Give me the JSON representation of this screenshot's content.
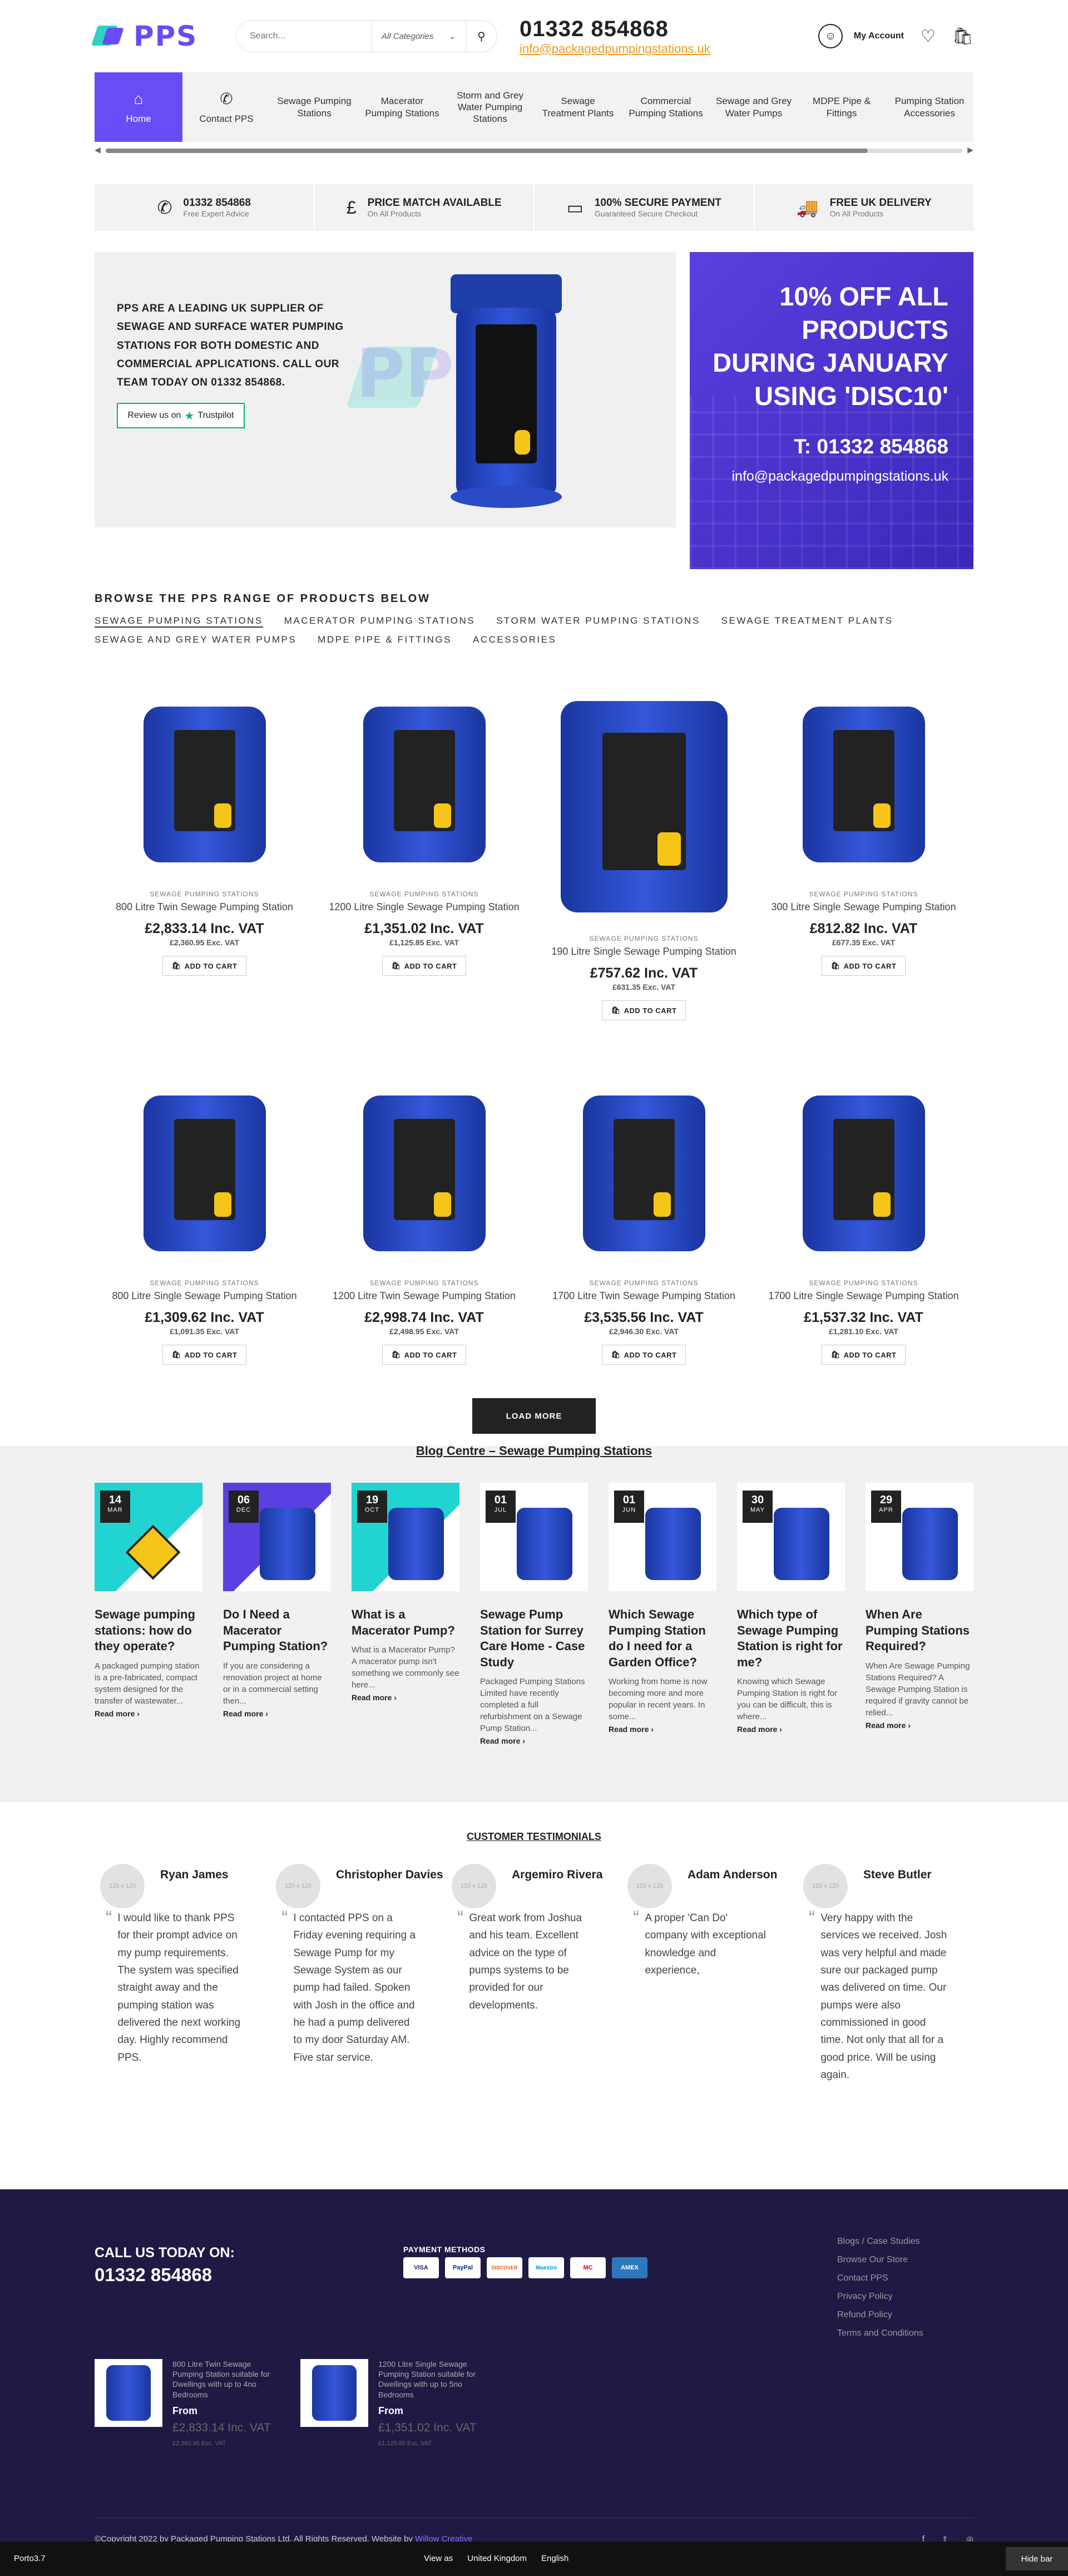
{
  "header": {
    "logo_text": "PPS",
    "search_placeholder": "Search...",
    "search_category": "All Categories",
    "phone": "01332 854868",
    "email": "info@packagedpumpingstations.uk",
    "account_label": "My Account"
  },
  "nav": {
    "items": [
      {
        "label": "Home",
        "icon": "home-icon"
      },
      {
        "label": "Contact PPS",
        "icon": "phone-icon"
      },
      {
        "label": "Sewage Pumping Stations"
      },
      {
        "label": "Macerator Pumping Stations"
      },
      {
        "label": "Storm and Grey Water Pumping Stations"
      },
      {
        "label": "Sewage Treatment Plants"
      },
      {
        "label": "Commercial Pumping Stations"
      },
      {
        "label": "Sewage and Grey Water Pumps"
      },
      {
        "label": "MDPE Pipe & Fittings"
      },
      {
        "label": "Pumping Station Accessories"
      }
    ]
  },
  "features": [
    {
      "title": "01332 854868",
      "sub": "Free Expert Advice",
      "icon": "phone-icon"
    },
    {
      "title": "PRICE MATCH AVAILABLE",
      "sub": "On All Products",
      "icon": "pound-icon"
    },
    {
      "title": "100% SECURE PAYMENT",
      "sub": "Guaranteed Secure Checkout",
      "icon": "card-icon"
    },
    {
      "title": "FREE UK DELIVERY",
      "sub": "On All Products",
      "icon": "truck-icon"
    }
  ],
  "hero": {
    "text": "PPS ARE A LEADING UK SUPPLIER OF SEWAGE AND SURFACE WATER PUMPING STATIONS FOR BOTH DOMESTIC AND COMMERCIAL APPLICATIONS. CALL OUR TEAM TODAY ON 01332 854868.",
    "trustpilot": "Review us on",
    "trustpilot_brand": "Trustpilot",
    "watermark": "PPS",
    "promo": "10% OFF ALL PRODUCTS DURING JANUARY USING 'DISC10'",
    "promo_phone": "T: 01332 854868",
    "promo_email": "info@packagedpumpingstations.uk"
  },
  "browse": {
    "title": "BROWSE THE PPS RANGE OF PRODUCTS BELOW",
    "tabs": [
      "SEWAGE PUMPING STATIONS",
      "MACERATOR PUMPING STATIONS",
      "STORM WATER PUMPING STATIONS",
      "SEWAGE TREATMENT PLANTS",
      "SEWAGE AND GREY WATER PUMPS",
      "MDPE PIPE & FITTINGS",
      "ACCESSORIES"
    ]
  },
  "products": [
    {
      "cat": "SEWAGE PUMPING STATIONS",
      "name": "800 Litre Twin Sewage Pumping Station",
      "price": "£2,833.14 Inc. VAT",
      "ex": "£2,360.95 Exc. VAT",
      "cart": "ADD TO CART"
    },
    {
      "cat": "SEWAGE PUMPING STATIONS",
      "name": "1200 Litre Single Sewage Pumping Station",
      "price": "£1,351.02 Inc. VAT",
      "ex": "£1,125.85 Exc. VAT",
      "cart": "ADD TO CART"
    },
    {
      "cat": "SEWAGE PUMPING STATIONS",
      "name": "190 Litre Single Sewage Pumping Station",
      "price": "£757.62 Inc. VAT",
      "ex": "£631.35 Exc. VAT",
      "cart": "ADD TO CART"
    },
    {
      "cat": "SEWAGE PUMPING STATIONS",
      "name": "300 Litre Single Sewage Pumping Station",
      "price": "£812.82 Inc. VAT",
      "ex": "£677.35 Exc. VAT",
      "cart": "ADD TO CART"
    },
    {
      "cat": "SEWAGE PUMPING STATIONS",
      "name": "800 Litre Single Sewage Pumping Station",
      "price": "£1,309.62 Inc. VAT",
      "ex": "£1,091.35 Exc. VAT",
      "cart": "ADD TO CART"
    },
    {
      "cat": "SEWAGE PUMPING STATIONS",
      "name": "1200 Litre Twin Sewage Pumping Station",
      "price": "£2,998.74 Inc. VAT",
      "ex": "£2,498.95 Exc. VAT",
      "cart": "ADD TO CART"
    },
    {
      "cat": "SEWAGE PUMPING STATIONS",
      "name": "1700 Litre Twin Sewage Pumping Station",
      "price": "£3,535.56 Inc. VAT",
      "ex": "£2,946.30 Exc. VAT",
      "cart": "ADD TO CART"
    },
    {
      "cat": "SEWAGE PUMPING STATIONS",
      "name": "1700 Litre Single Sewage Pumping Station",
      "price": "£1,537.32 Inc. VAT",
      "ex": "£1,281.10 Exc. VAT",
      "cart": "ADD TO CART"
    }
  ],
  "load_more": "LOAD MORE",
  "blog": {
    "title": "Blog Centre – Sewage Pumping Stations",
    "posts": [
      {
        "day": "14",
        "month": "MAR",
        "title": "Sewage pumping stations: how do they operate?",
        "excerpt": "A packaged pumping station is a pre-fabricated, compact system designed for the transfer of wastewater...",
        "more": "Read more ›"
      },
      {
        "day": "06",
        "month": "DEC",
        "title": "Do I Need a Macerator Pumping Station?",
        "excerpt": "If you are considering a renovation project at home or in a commercial setting then...",
        "more": "Read more ›"
      },
      {
        "day": "19",
        "month": "OCT",
        "title": "What is a Macerator Pump?",
        "excerpt": "What is a Macerator Pump? A macerator pump isn't something we commonly see here...",
        "more": "Read more ›"
      },
      {
        "day": "01",
        "month": "JUL",
        "title": "Sewage Pump Station for Surrey Care Home - Case Study",
        "excerpt": "Packaged Pumping Stations Limited have recently completed a full refurbishment on a Sewage Pump Station...",
        "more": "Read more ›"
      },
      {
        "day": "01",
        "month": "JUN",
        "title": "Which Sewage Pumping Station do I need for a Garden Office?",
        "excerpt": "Working from home is now becoming more and more popular in recent years. In some...",
        "more": "Read more ›"
      },
      {
        "day": "30",
        "month": "MAY",
        "title": "Which type of Sewage Pumping Station is right for me?",
        "excerpt": "Knowing which Sewage Pumping Station is right for you can be difficult, this is where...",
        "more": "Read more ›"
      },
      {
        "day": "29",
        "month": "APR",
        "title": "When Are Pumping Stations Required?",
        "excerpt": "When Are Sewage Pumping Stations Required? A Sewage Pumping Station is required if gravity cannot be relied...",
        "more": "Read more ›"
      }
    ]
  },
  "testimonials": {
    "title": "CUSTOMER TESTIMONIALS",
    "avatar_text": "120 x 120",
    "items": [
      {
        "name": "Ryan James",
        "text": "I would like to thank PPS for their prompt advice on my pump requirements. The system was specified straight away and the pumping station was delivered the next working day. Highly recommend PPS."
      },
      {
        "name": "Christopher Davies",
        "text": "I contacted PPS on a Friday evening requiring a Sewage Pump for my Sewage System as our pump had failed. Spoken with Josh in the office and he had a pump delivered to my door Saturday AM. Five star service."
      },
      {
        "name": "Argemiro Rivera",
        "text": "Great work from Joshua and his team. Excellent advice on the type of pumps systems to be provided for our developments."
      },
      {
        "name": "Adam Anderson",
        "text": "A proper 'Can Do' company with exceptional knowledge and experience,"
      },
      {
        "name": "Steve Butler",
        "text": "Very happy with the services we received. Josh was very helpful and made sure our packaged pump was delivered on time. Our pumps were also commissioned in good time. Not only that all for a good price. Will be using again."
      }
    ]
  },
  "footer": {
    "call_label": "CALL US TODAY ON:",
    "call_phone": "01332 854868",
    "payment_title": "PAYMENT METHODS",
    "cards": [
      "VISA",
      "PayPal",
      "DISCOVER",
      "Maestro",
      "MC",
      "AMEX"
    ],
    "links": [
      "Blogs / Case Studies",
      "Browse Our Store",
      "Contact PPS",
      "Privacy Policy",
      "Refund Policy",
      "Terms and Conditions"
    ],
    "products": [
      {
        "name": "800 Litre Twin Sewage Pumping Station suitable for Dwellings with up to 4no Bedrooms",
        "from": "From",
        "price": "£2,833.14 Inc. VAT",
        "ex": "£2,360.95 Exc. VAT"
      },
      {
        "name": "1200 Litre Single Sewage Pumping Station suitable for Dwellings with up to 5no Bedrooms",
        "from": "From",
        "price": "£1,351.02 Inc. VAT",
        "ex": "£1,125.85 Exc. VAT"
      }
    ],
    "copyright": "©Copyright 2022 by Packaged Pumping Stations Ltd. All Rights Reserved. Website by",
    "copyright_by": "Willow Creative"
  },
  "preview_bar": {
    "theme": "Porto3.7",
    "view_as": "View as",
    "country": "United Kingdom",
    "language": "English",
    "hide": "Hide bar"
  }
}
